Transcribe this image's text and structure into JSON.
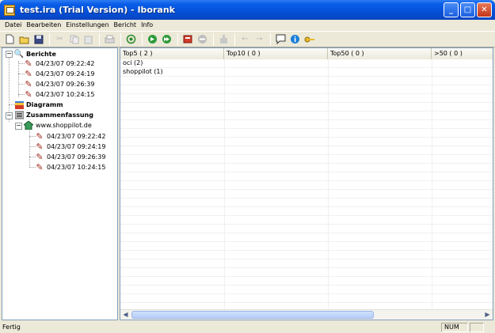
{
  "window": {
    "title": "test.ira (Trial Version)  - Iborank",
    "minimize_label": "_",
    "maximize_label": "□",
    "close_label": "✕"
  },
  "menu": [
    "Datei",
    "Bearbeiten",
    "Einstellungen",
    "Bericht",
    "Info"
  ],
  "tree": {
    "berichte": {
      "label": "Berichte",
      "items": [
        "04/23/07 09:22:42",
        "04/23/07 09:24:19",
        "04/23/07 09:26:39",
        "04/23/07 10:24:15"
      ]
    },
    "diagramm": {
      "label": "Diagramm"
    },
    "zusammenfassung": {
      "label": "Zusammenfassung",
      "site": "www.shoppilot.de",
      "items": [
        "04/23/07 09:22:42",
        "04/23/07 09:24:19",
        "04/23/07 09:26:39",
        "04/23/07 10:24:15"
      ]
    }
  },
  "list": {
    "columns": [
      "Top5 ( 2 )",
      "Top10 ( 0 )",
      "Top50 ( 0 )",
      ">50 ( 0 )"
    ],
    "rows": [
      "oci (2)",
      "shoppilot (1)"
    ]
  },
  "status": {
    "text": "Fertig",
    "num": "NUM"
  },
  "colors": {
    "titlebar": "#0550d8",
    "pane_border": "#7f9db9",
    "background": "#ece9d8"
  }
}
